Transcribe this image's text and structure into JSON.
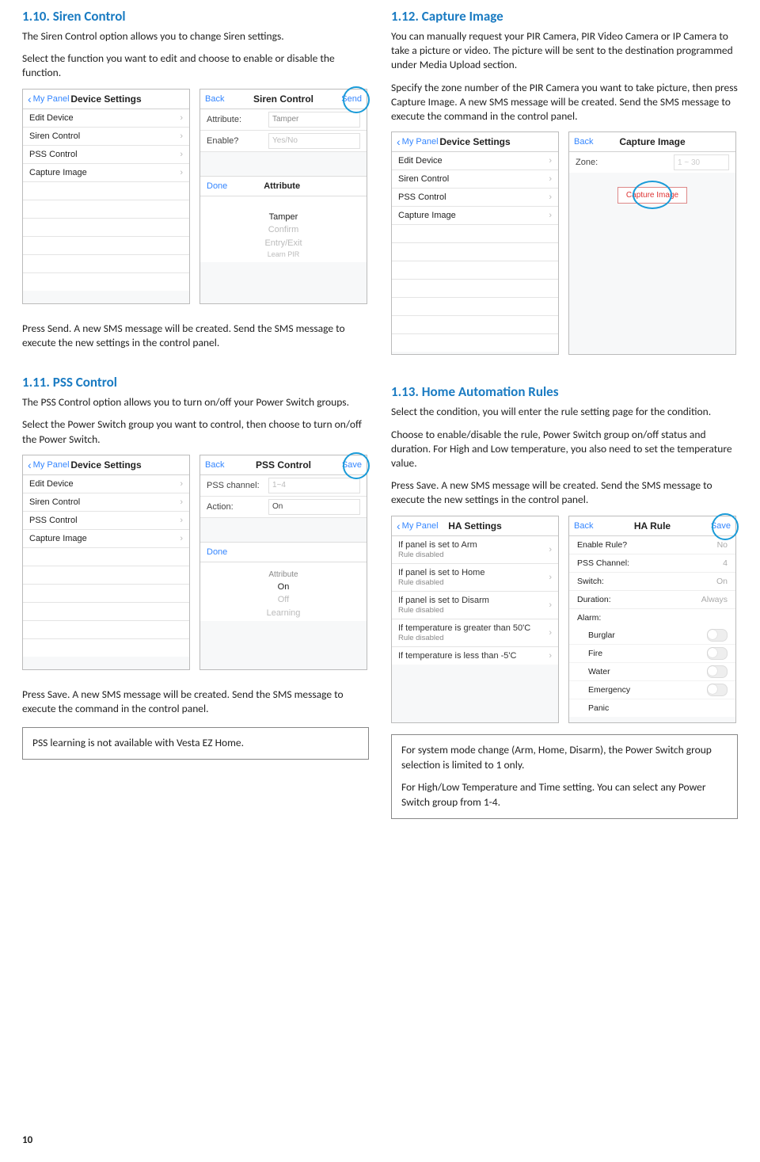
{
  "page_number": "10",
  "left": {
    "s110": {
      "heading": "1.10. Siren Control",
      "p1": "The Siren Control option allows you to change Siren settings.",
      "p2": "Select the function you want to edit and choose to enable or disable the function.",
      "after": "Press Send. A new SMS message will be created. Send the SMS message to execute the new settings in the control panel."
    },
    "s111": {
      "heading": "1.11. PSS Control",
      "p1": "The PSS Control option allows you to turn on/off your Power Switch groups.",
      "p2": "Select the Power Switch group you want to control, then choose to turn on/off the Power Switch.",
      "after": "Press Save. A new SMS message will be created. Send the SMS message to execute the command in the control panel.",
      "note": "PSS learning is not available with Vesta EZ Home."
    }
  },
  "right": {
    "s112": {
      "heading": "1.12. Capture Image",
      "p1": "You can manually request your PIR Camera, PIR Video Camera or IP Camera to take a picture or video. The picture will be sent to the destination programmed under Media Upload section.",
      "p2": "Specify the zone number of the PIR Camera you want to take picture, then press Capture Image. A new SMS message will be created. Send the SMS message to execute the command in the control panel."
    },
    "s113": {
      "heading": "1.13. Home Automation Rules",
      "p1": "Select the condition, you will enter the rule setting page for the condition.",
      "p2": "Choose to enable/disable the rule, Power Switch group on/off status and duration. For High and Low temperature, you also need to set the temperature value.",
      "p3": "Press Save. A new SMS message will be created. Send the SMS message to execute the new settings in the control panel.",
      "note1": "For system mode change (Arm, Home, Disarm), the Power Switch group selection is limited to 1 only.",
      "note2": "For High/Low Temperature and Time setting. You can select any Power Switch group from 1-4."
    }
  },
  "mock": {
    "dev_settings": {
      "back": "My Panel",
      "title": "Device Settings",
      "items": [
        "Edit Device",
        "Siren Control",
        "PSS Control",
        "Capture Image"
      ]
    },
    "siren": {
      "back": "Back",
      "title": "Siren Control",
      "right": "Send",
      "rows": [
        {
          "lbl": "Attribute:",
          "val": "Tamper"
        },
        {
          "lbl": "Enable?",
          "val": "Yes/No"
        }
      ],
      "picker_done": "Done",
      "picker_title": "Attribute",
      "picker_opts": [
        "Tamper",
        "Confirm",
        "Entry/Exit",
        "Learn PIR"
      ],
      "picker_sel": "Tamper"
    },
    "pss": {
      "back": "Back",
      "title": "PSS Control",
      "right": "Save",
      "rows": [
        {
          "lbl": "PSS channel:",
          "val": "1~4"
        },
        {
          "lbl": "Action:",
          "val": "On"
        }
      ],
      "picker_done": "Done",
      "picker_title": "Attribute",
      "picker_opts": [
        "On",
        "Off",
        "Learning"
      ],
      "picker_sel": "On"
    },
    "cap": {
      "back": "Back",
      "title": "Capture Image",
      "zone_lbl": "Zone:",
      "zone_val": "1 ~ 30",
      "btn": "Capture Image"
    },
    "ha_list": {
      "back": "My Panel",
      "title": "HA Settings",
      "rows": [
        {
          "t": "If panel is set to Arm",
          "s": "Rule disabled"
        },
        {
          "t": "If panel is set to Home",
          "s": "Rule disabled"
        },
        {
          "t": "If panel is set to Disarm",
          "s": "Rule disabled"
        },
        {
          "t": "If temperature is greater than 50'C",
          "s": "Rule disabled"
        },
        {
          "t": "If temperature is less than -5'C",
          "s": ""
        }
      ]
    },
    "ha_rule": {
      "back": "Back",
      "title": "HA Rule",
      "right": "Save",
      "kv": [
        {
          "k": "Enable Rule?",
          "v": "No"
        },
        {
          "k": "PSS Channel:",
          "v": "4"
        },
        {
          "k": "Switch:",
          "v": "On"
        },
        {
          "k": "Duration:",
          "v": "Always"
        }
      ],
      "alarm_label": "Alarm:",
      "alarms": [
        "Burglar",
        "Fire",
        "Water",
        "Emergency",
        "Panic"
      ]
    }
  }
}
